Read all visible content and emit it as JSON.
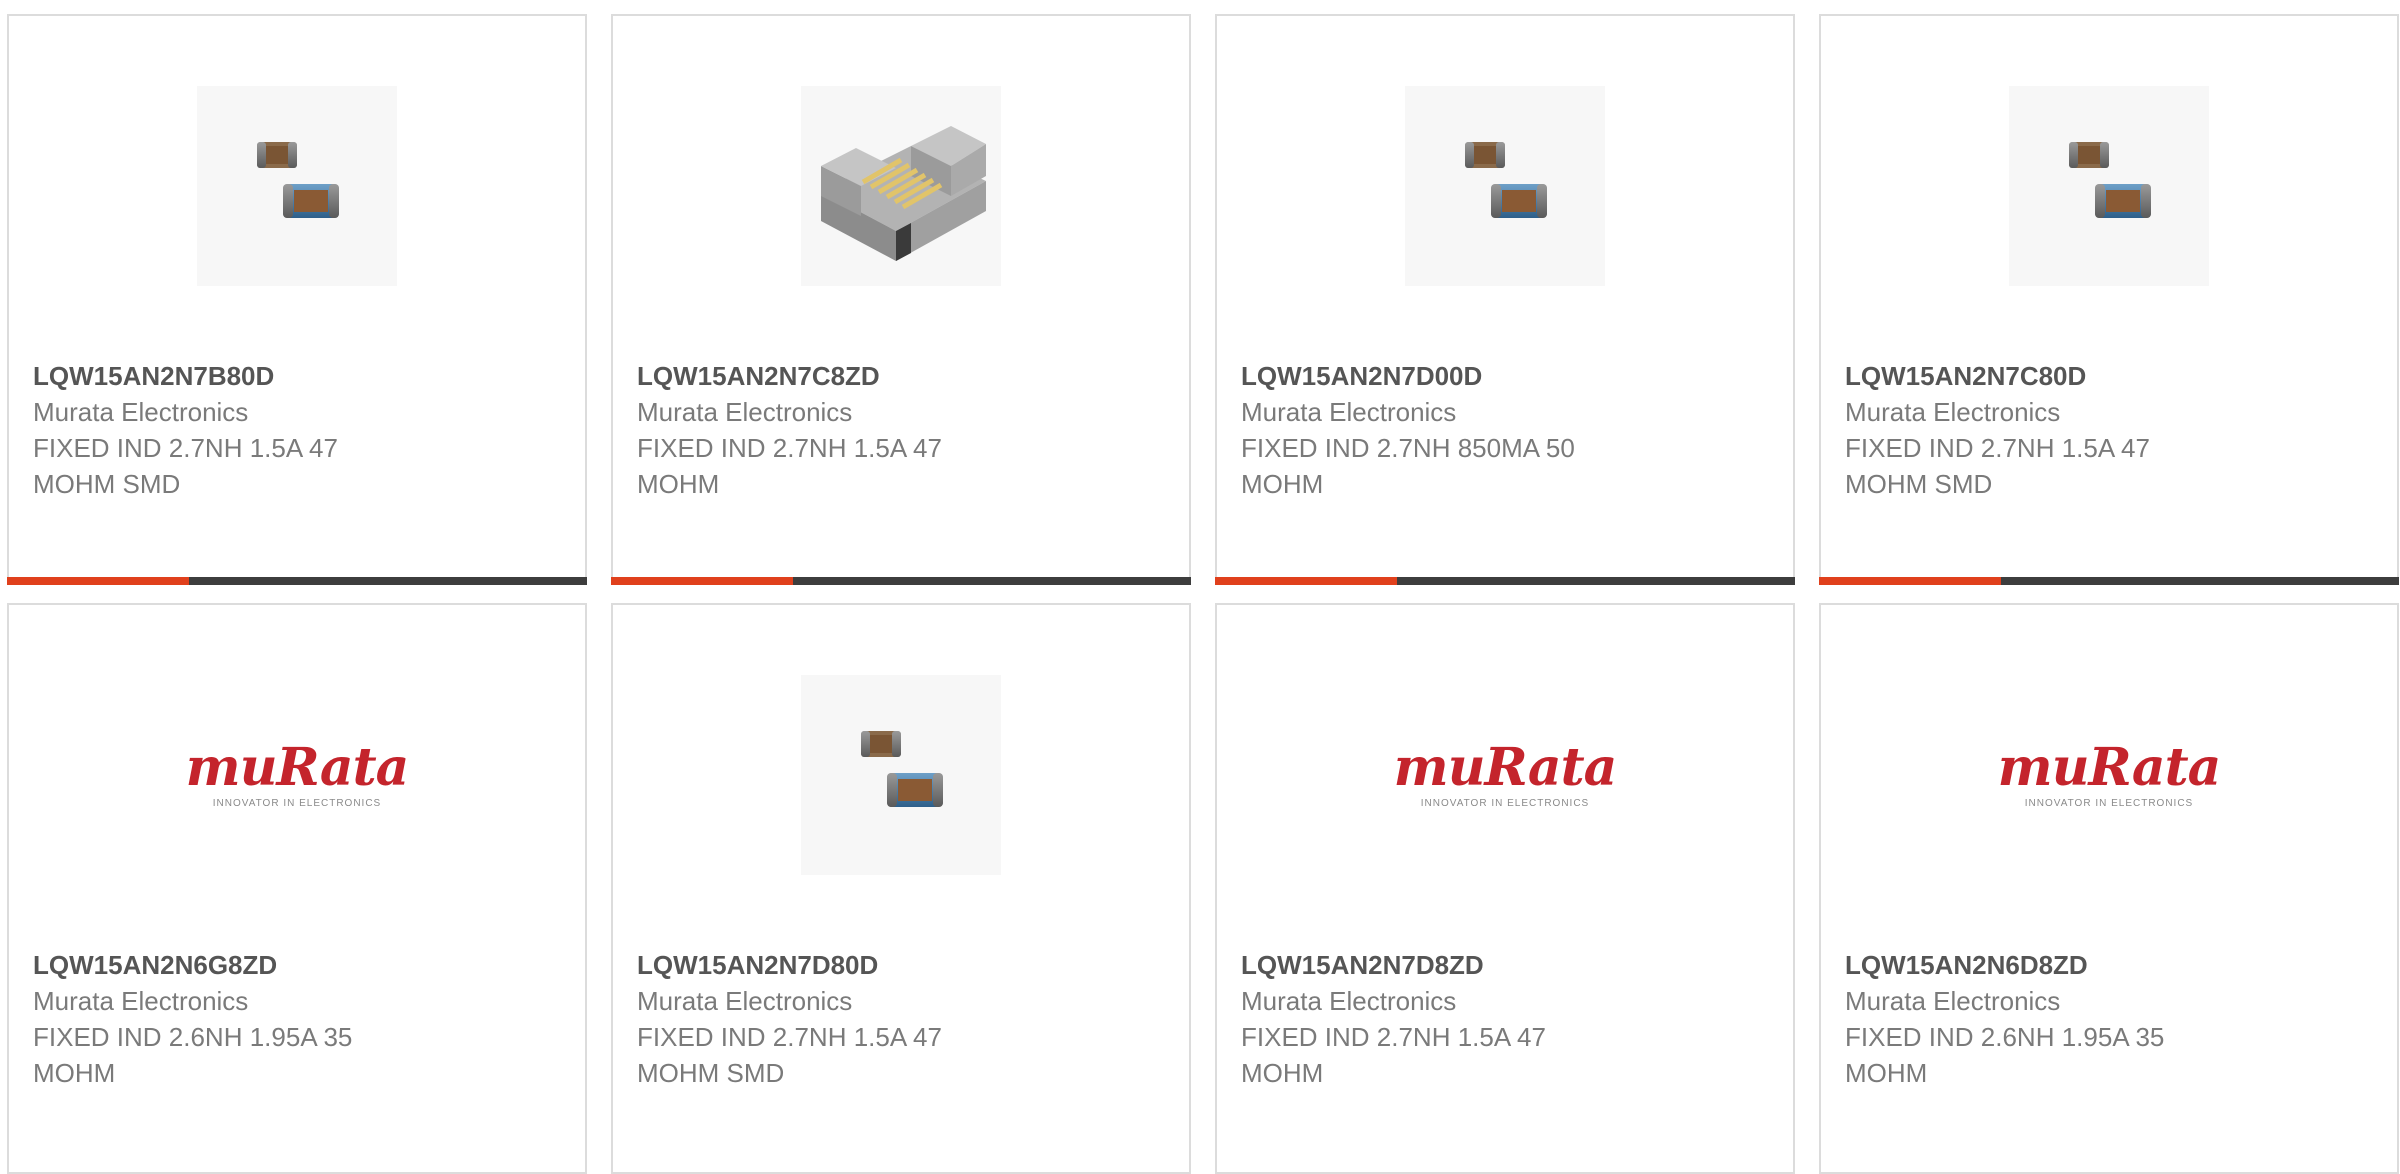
{
  "brand": {
    "accent_color": "#e0401c",
    "bar_color": "#3d3d3d",
    "logo_text": "muRata",
    "logo_tagline": "INNOVATOR IN ELECTRONICS"
  },
  "products": [
    {
      "part_number": "LQW15AN2N7B80D",
      "manufacturer": "Murata Electronics",
      "description": "FIXED IND 2.7NH 1.5A 47\nMOHM SMD",
      "image": "chip-pair"
    },
    {
      "part_number": "LQW15AN2N7C8ZD",
      "manufacturer": "Murata Electronics",
      "description": "FIXED IND 2.7NH 1.5A 47\nMOHM",
      "image": "wirewound"
    },
    {
      "part_number": "LQW15AN2N7D00D",
      "manufacturer": "Murata Electronics",
      "description": "FIXED IND 2.7NH 850MA 50\nMOHM",
      "image": "chip-pair"
    },
    {
      "part_number": "LQW15AN2N7C80D",
      "manufacturer": "Murata Electronics",
      "description": "FIXED IND 2.7NH 1.5A 47\nMOHM SMD",
      "image": "chip-pair"
    },
    {
      "part_number": "LQW15AN2N6G8ZD",
      "manufacturer": "Murata Electronics",
      "description": "FIXED IND 2.6NH 1.95A 35\nMOHM",
      "image": "logo"
    },
    {
      "part_number": "LQW15AN2N7D80D",
      "manufacturer": "Murata Electronics",
      "description": "FIXED IND 2.7NH 1.5A 47\nMOHM SMD",
      "image": "chip-pair"
    },
    {
      "part_number": "LQW15AN2N7D8ZD",
      "manufacturer": "Murata Electronics",
      "description": "FIXED IND 2.7NH 1.5A 47\nMOHM",
      "image": "logo"
    },
    {
      "part_number": "LQW15AN2N6D8ZD",
      "manufacturer": "Murata Electronics",
      "description": "FIXED IND 2.6NH 1.95A 35\nMOHM",
      "image": "logo"
    }
  ]
}
